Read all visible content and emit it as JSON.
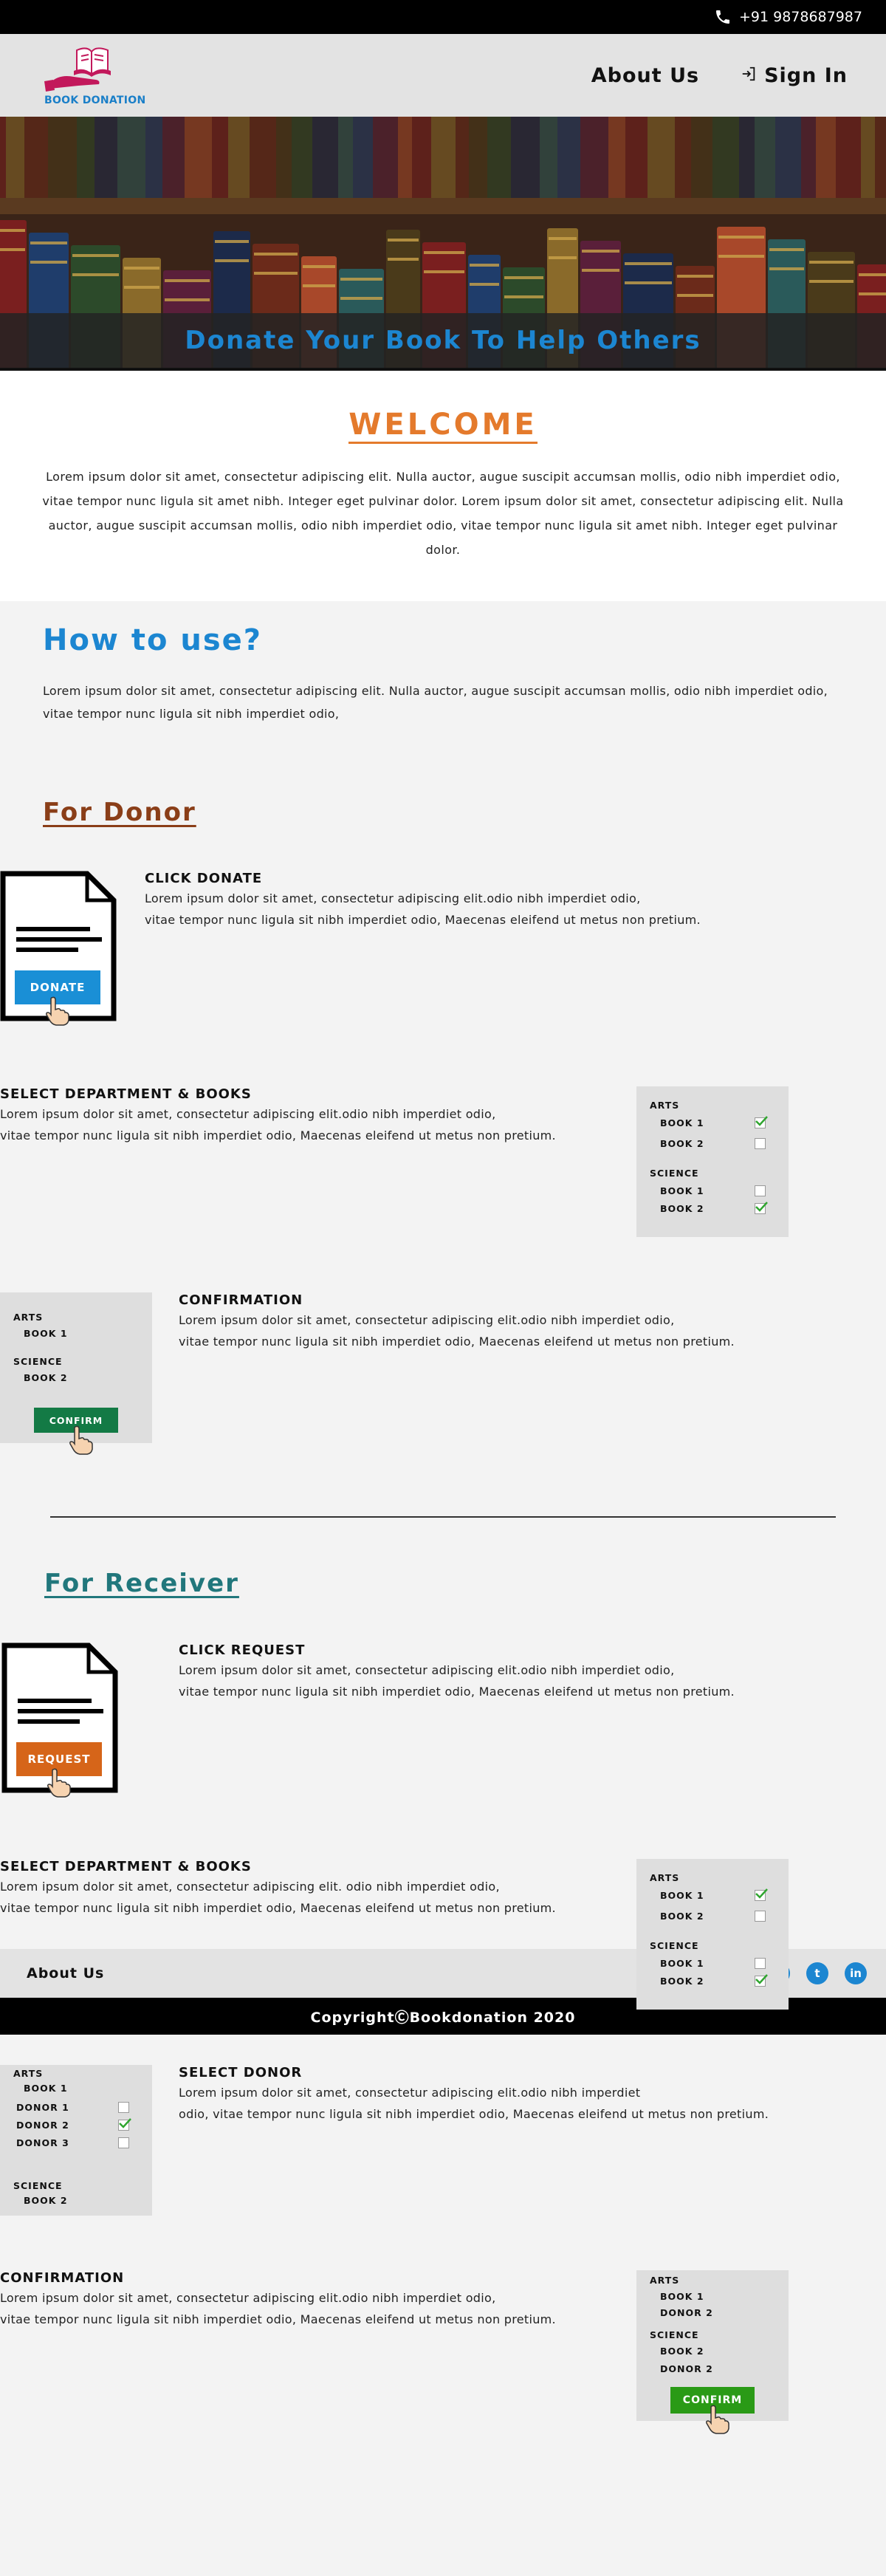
{
  "topbar": {
    "phone": "+91 9878687987",
    "icon": "phone-icon"
  },
  "header": {
    "logo_text": "BOOK DONATION",
    "nav": {
      "about": "About Us",
      "signin": "Sign In"
    }
  },
  "hero": {
    "caption": "Donate Your Book To Help Others"
  },
  "welcome": {
    "title": "WELCOME",
    "text": "Lorem ipsum dolor sit amet, consectetur adipiscing elit. Nulla auctor, augue suscipit accumsan mollis, odio nibh imperdiet odio, vitae tempor nunc ligula sit amet nibh. Integer eget pulvinar dolor. Lorem ipsum dolor sit amet, consectetur adipiscing elit. Nulla auctor, augue suscipit accumsan mollis, odio nibh imperdiet odio, vitae tempor nunc ligula sit amet nibh. Integer eget pulvinar dolor."
  },
  "howto": {
    "title": "How to use?",
    "intro": "Lorem ipsum dolor sit amet, consectetur adipiscing elit. Nulla auctor, augue suscipit accumsan mollis, odio nibh imperdiet odio, vitae tempor nunc ligula sit nibh imperdiet odio,"
  },
  "donor": {
    "title": "For Donor",
    "click_title": "CLICK DONATE",
    "click_text_1": "Lorem ipsum dolor sit amet, consectetur adipiscing elit.odio nibh imperdiet odio,",
    "click_text_2": "vitae tempor nunc ligula sit nibh imperdiet odio, Maecenas eleifend ut metus non pretium.",
    "donate_btn": "DONATE",
    "select_title": "SELECT DEPARTMENT & BOOKS",
    "select_text_1": "Lorem ipsum dolor sit amet, consectetur adipiscing elit.odio nibh imperdiet odio,",
    "select_text_2": "vitae tempor nunc ligula sit nibh imperdiet odio, Maecenas eleifend ut metus non pretium.",
    "panel": {
      "cat1": "ARTS",
      "item1": "BOOK 1",
      "item2": "BOOK 2",
      "cat2": "SCIENCE",
      "item3": "BOOK 1",
      "item4": "BOOK 2"
    },
    "confirm_title": "CONFIRMATION",
    "confirm_text_1": "Lorem ipsum dolor sit amet, consectetur adipiscing elit.odio nibh imperdiet odio,",
    "confirm_text_2": "vitae tempor nunc ligula sit nibh imperdiet odio, Maecenas eleifend ut metus non pretium.",
    "confirm_panel": {
      "cat1": "ARTS",
      "item1": "BOOK 1",
      "cat2": "SCIENCE",
      "item2": "BOOK 2",
      "btn": "CONFIRM"
    }
  },
  "receiver": {
    "title": "For Receiver",
    "click_title": "CLICK REQUEST",
    "click_text_1": "Lorem ipsum dolor sit amet, consectetur adipiscing elit.odio nibh imperdiet odio,",
    "click_text_2": "vitae tempor nunc ligula sit nibh imperdiet odio, Maecenas eleifend ut metus non pretium.",
    "request_btn": "REQUEST",
    "select_title": "SELECT DEPARTMENT & BOOKS",
    "select_text_1": "Lorem ipsum dolor sit amet, consectetur adipiscing elit. odio nibh imperdiet odio,",
    "select_text_2": "vitae tempor nunc ligula sit nibh imperdiet odio,  Maecenas eleifend ut metus non pretium.",
    "panel": {
      "cat1": "ARTS",
      "item1": "BOOK 1",
      "item2": "BOOK 2",
      "cat2": "SCIENCE",
      "item3": "BOOK 1",
      "item4": "BOOK 2"
    },
    "donor_title": "SELECT DONOR",
    "donor_text_1": "Lorem ipsum dolor sit amet, consectetur adipiscing elit.odio nibh imperdiet",
    "donor_text_2": "odio, vitae tempor nunc ligula sit nibh imperdiet odio, Maecenas eleifend ut metus non pretium.",
    "donor_panel": {
      "cat1": "ARTS",
      "book": "BOOK 1",
      "d1": "DONOR 1",
      "d2": "DONOR 2",
      "d3": "DONOR 3",
      "cat2": "SCIENCE",
      "book2": "BOOK 2"
    },
    "confirm_title": "CONFIRMATION",
    "confirm_text_1": "Lorem ipsum dolor sit amet, consectetur adipiscing elit.odio nibh imperdiet odio,",
    "confirm_text_2": "vitae tempor nunc ligula sit nibh imperdiet odio, Maecenas eleifend ut metus non pretium.",
    "confirm_panel": {
      "cat1": "ARTS",
      "b1": "BOOK 1",
      "d1": "DONOR 2",
      "cat2": "SCIENCE",
      "b2": "BOOK 2",
      "d2": "DONOR 2",
      "btn": "CONFIRM"
    }
  },
  "footer": {
    "about": "About Us",
    "social": {
      "facebook": "f",
      "twitter": "t",
      "linkedin": "in"
    },
    "copyright": "CopyrightⒸBookdonation 2020"
  },
  "colors": {
    "accent_blue": "#1c86d1",
    "welcome_orange": "#e47a2c",
    "donor_brown": "#8a3e18",
    "receiver_teal": "#21777c",
    "confirm_green_1": "#137a45",
    "confirm_green_2": "#2a9a16"
  }
}
